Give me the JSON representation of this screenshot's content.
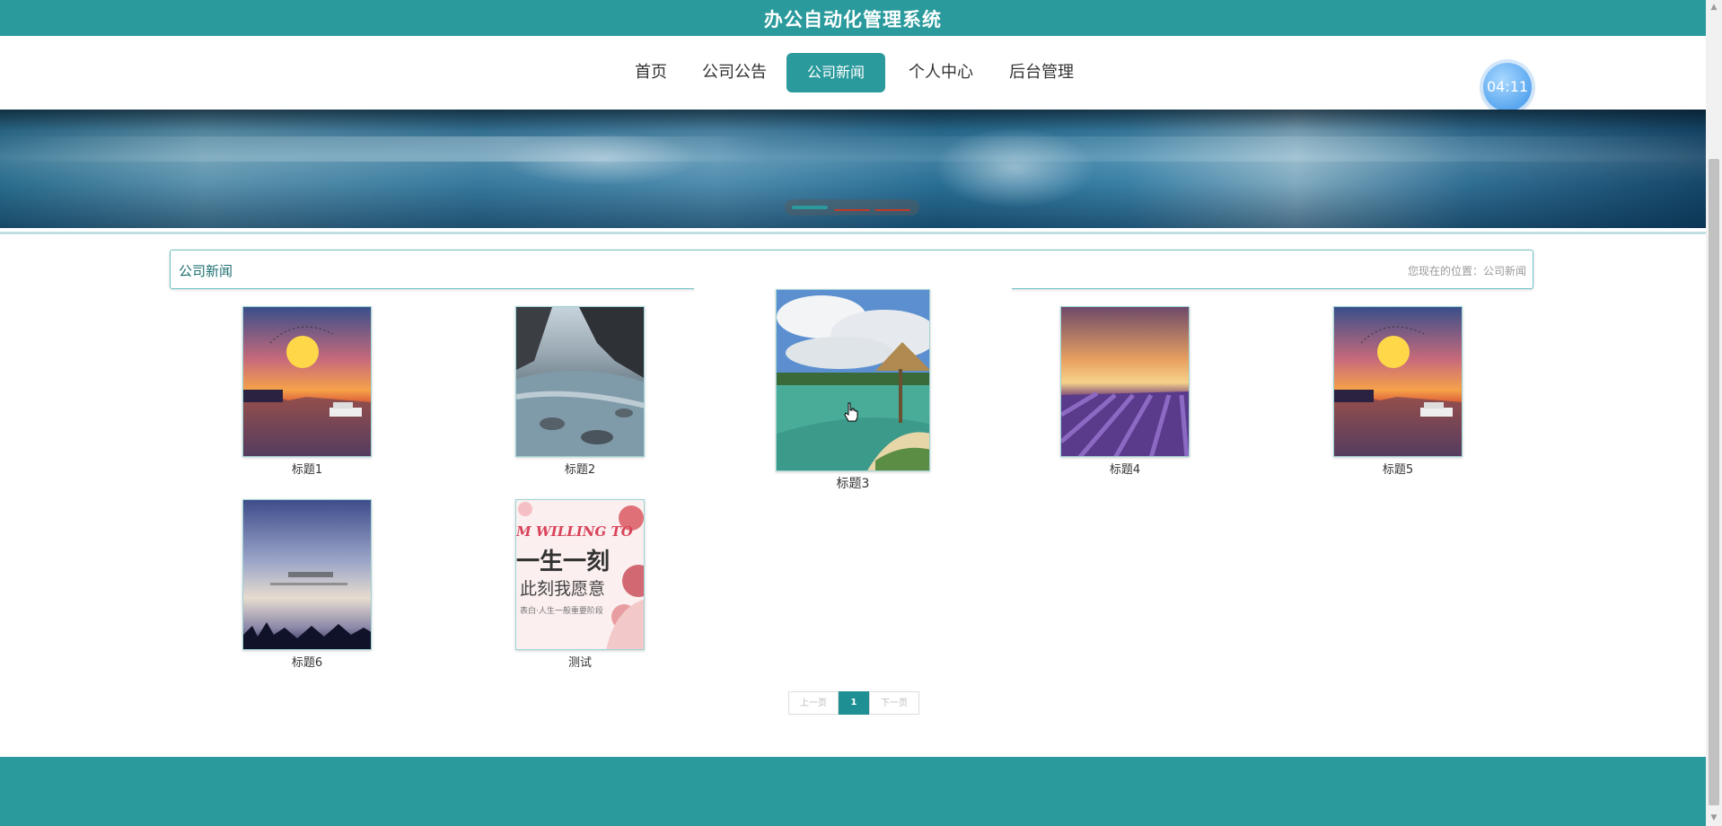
{
  "app": {
    "title": "办公自动化管理系统"
  },
  "nav": {
    "items": [
      {
        "label": "首页",
        "active": false
      },
      {
        "label": "公司公告",
        "active": false
      },
      {
        "label": "公司新闻",
        "active": true
      },
      {
        "label": "个人中心",
        "active": false
      },
      {
        "label": "后台管理",
        "active": false
      }
    ]
  },
  "clock": {
    "time": "04:11"
  },
  "banner": {
    "slide_count": 3,
    "active_slide": 1,
    "active_dot_color": "#2a9a9c",
    "inactive_dot_color": "#c0392b"
  },
  "section": {
    "title": "公司新闻",
    "location_prefix": "您现在的位置：",
    "location": "公司新闻"
  },
  "news": [
    {
      "title": "标题1",
      "image": "sunset-river-boats"
    },
    {
      "title": "标题2",
      "image": "mountain-stream"
    },
    {
      "title": "标题3",
      "image": "tropical-beach-hut"
    },
    {
      "title": "标题4",
      "image": "lavender-field-sunset"
    },
    {
      "title": "标题5",
      "image": "sunset-river-boats"
    },
    {
      "title": "标题6",
      "image": "dusk-sky-grass"
    },
    {
      "title": "测试",
      "image": "red-flower-poster",
      "poster_lines": [
        "M WILLING TO",
        "一生一刻",
        "此刻我愿意",
        "表白·人生一般重要阶段"
      ]
    }
  ],
  "pagination": {
    "prev": "上一页",
    "current": "1",
    "next": "下一页"
  },
  "colors": {
    "brand": "#2a9a9c",
    "accent_dark": "#1e8f92"
  }
}
